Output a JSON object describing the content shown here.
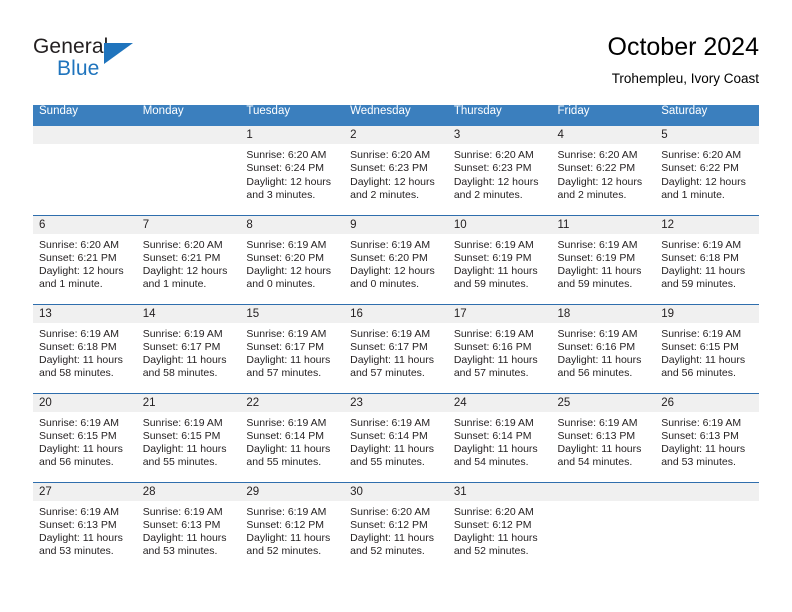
{
  "brand": {
    "name_part1": "General",
    "name_part2": "Blue",
    "triangle_icon": "triangle-icon",
    "accent_color": "#1f74bd"
  },
  "header": {
    "title": "October 2024",
    "subtitle": "Trohempleu, Ivory Coast"
  },
  "calendar": {
    "header_bg": "#3b7fbe",
    "row_divider": "#2f6ead",
    "daynum_bg": "#f0f0f0",
    "weekdays": [
      "Sunday",
      "Monday",
      "Tuesday",
      "Wednesday",
      "Thursday",
      "Friday",
      "Saturday"
    ],
    "weeks": [
      [
        {
          "day": "",
          "sunrise": "",
          "sunset": "",
          "daylight": "",
          "daylight2": "",
          "blank": true
        },
        {
          "day": "",
          "sunrise": "",
          "sunset": "",
          "daylight": "",
          "daylight2": "",
          "blank": true
        },
        {
          "day": "1",
          "sunrise": "Sunrise: 6:20 AM",
          "sunset": "Sunset: 6:24 PM",
          "daylight": "Daylight: 12 hours",
          "daylight2": "and 3 minutes."
        },
        {
          "day": "2",
          "sunrise": "Sunrise: 6:20 AM",
          "sunset": "Sunset: 6:23 PM",
          "daylight": "Daylight: 12 hours",
          "daylight2": "and 2 minutes."
        },
        {
          "day": "3",
          "sunrise": "Sunrise: 6:20 AM",
          "sunset": "Sunset: 6:23 PM",
          "daylight": "Daylight: 12 hours",
          "daylight2": "and 2 minutes."
        },
        {
          "day": "4",
          "sunrise": "Sunrise: 6:20 AM",
          "sunset": "Sunset: 6:22 PM",
          "daylight": "Daylight: 12 hours",
          "daylight2": "and 2 minutes."
        },
        {
          "day": "5",
          "sunrise": "Sunrise: 6:20 AM",
          "sunset": "Sunset: 6:22 PM",
          "daylight": "Daylight: 12 hours",
          "daylight2": "and 1 minute."
        }
      ],
      [
        {
          "day": "6",
          "sunrise": "Sunrise: 6:20 AM",
          "sunset": "Sunset: 6:21 PM",
          "daylight": "Daylight: 12 hours",
          "daylight2": "and 1 minute."
        },
        {
          "day": "7",
          "sunrise": "Sunrise: 6:20 AM",
          "sunset": "Sunset: 6:21 PM",
          "daylight": "Daylight: 12 hours",
          "daylight2": "and 1 minute."
        },
        {
          "day": "8",
          "sunrise": "Sunrise: 6:19 AM",
          "sunset": "Sunset: 6:20 PM",
          "daylight": "Daylight: 12 hours",
          "daylight2": "and 0 minutes."
        },
        {
          "day": "9",
          "sunrise": "Sunrise: 6:19 AM",
          "sunset": "Sunset: 6:20 PM",
          "daylight": "Daylight: 12 hours",
          "daylight2": "and 0 minutes."
        },
        {
          "day": "10",
          "sunrise": "Sunrise: 6:19 AM",
          "sunset": "Sunset: 6:19 PM",
          "daylight": "Daylight: 11 hours",
          "daylight2": "and 59 minutes."
        },
        {
          "day": "11",
          "sunrise": "Sunrise: 6:19 AM",
          "sunset": "Sunset: 6:19 PM",
          "daylight": "Daylight: 11 hours",
          "daylight2": "and 59 minutes."
        },
        {
          "day": "12",
          "sunrise": "Sunrise: 6:19 AM",
          "sunset": "Sunset: 6:18 PM",
          "daylight": "Daylight: 11 hours",
          "daylight2": "and 59 minutes."
        }
      ],
      [
        {
          "day": "13",
          "sunrise": "Sunrise: 6:19 AM",
          "sunset": "Sunset: 6:18 PM",
          "daylight": "Daylight: 11 hours",
          "daylight2": "and 58 minutes."
        },
        {
          "day": "14",
          "sunrise": "Sunrise: 6:19 AM",
          "sunset": "Sunset: 6:17 PM",
          "daylight": "Daylight: 11 hours",
          "daylight2": "and 58 minutes."
        },
        {
          "day": "15",
          "sunrise": "Sunrise: 6:19 AM",
          "sunset": "Sunset: 6:17 PM",
          "daylight": "Daylight: 11 hours",
          "daylight2": "and 57 minutes."
        },
        {
          "day": "16",
          "sunrise": "Sunrise: 6:19 AM",
          "sunset": "Sunset: 6:17 PM",
          "daylight": "Daylight: 11 hours",
          "daylight2": "and 57 minutes."
        },
        {
          "day": "17",
          "sunrise": "Sunrise: 6:19 AM",
          "sunset": "Sunset: 6:16 PM",
          "daylight": "Daylight: 11 hours",
          "daylight2": "and 57 minutes."
        },
        {
          "day": "18",
          "sunrise": "Sunrise: 6:19 AM",
          "sunset": "Sunset: 6:16 PM",
          "daylight": "Daylight: 11 hours",
          "daylight2": "and 56 minutes."
        },
        {
          "day": "19",
          "sunrise": "Sunrise: 6:19 AM",
          "sunset": "Sunset: 6:15 PM",
          "daylight": "Daylight: 11 hours",
          "daylight2": "and 56 minutes."
        }
      ],
      [
        {
          "day": "20",
          "sunrise": "Sunrise: 6:19 AM",
          "sunset": "Sunset: 6:15 PM",
          "daylight": "Daylight: 11 hours",
          "daylight2": "and 56 minutes."
        },
        {
          "day": "21",
          "sunrise": "Sunrise: 6:19 AM",
          "sunset": "Sunset: 6:15 PM",
          "daylight": "Daylight: 11 hours",
          "daylight2": "and 55 minutes."
        },
        {
          "day": "22",
          "sunrise": "Sunrise: 6:19 AM",
          "sunset": "Sunset: 6:14 PM",
          "daylight": "Daylight: 11 hours",
          "daylight2": "and 55 minutes."
        },
        {
          "day": "23",
          "sunrise": "Sunrise: 6:19 AM",
          "sunset": "Sunset: 6:14 PM",
          "daylight": "Daylight: 11 hours",
          "daylight2": "and 55 minutes."
        },
        {
          "day": "24",
          "sunrise": "Sunrise: 6:19 AM",
          "sunset": "Sunset: 6:14 PM",
          "daylight": "Daylight: 11 hours",
          "daylight2": "and 54 minutes."
        },
        {
          "day": "25",
          "sunrise": "Sunrise: 6:19 AM",
          "sunset": "Sunset: 6:13 PM",
          "daylight": "Daylight: 11 hours",
          "daylight2": "and 54 minutes."
        },
        {
          "day": "26",
          "sunrise": "Sunrise: 6:19 AM",
          "sunset": "Sunset: 6:13 PM",
          "daylight": "Daylight: 11 hours",
          "daylight2": "and 53 minutes."
        }
      ],
      [
        {
          "day": "27",
          "sunrise": "Sunrise: 6:19 AM",
          "sunset": "Sunset: 6:13 PM",
          "daylight": "Daylight: 11 hours",
          "daylight2": "and 53 minutes."
        },
        {
          "day": "28",
          "sunrise": "Sunrise: 6:19 AM",
          "sunset": "Sunset: 6:13 PM",
          "daylight": "Daylight: 11 hours",
          "daylight2": "and 53 minutes."
        },
        {
          "day": "29",
          "sunrise": "Sunrise: 6:19 AM",
          "sunset": "Sunset: 6:12 PM",
          "daylight": "Daylight: 11 hours",
          "daylight2": "and 52 minutes."
        },
        {
          "day": "30",
          "sunrise": "Sunrise: 6:20 AM",
          "sunset": "Sunset: 6:12 PM",
          "daylight": "Daylight: 11 hours",
          "daylight2": "and 52 minutes."
        },
        {
          "day": "31",
          "sunrise": "Sunrise: 6:20 AM",
          "sunset": "Sunset: 6:12 PM",
          "daylight": "Daylight: 11 hours",
          "daylight2": "and 52 minutes."
        },
        {
          "day": "",
          "sunrise": "",
          "sunset": "",
          "daylight": "",
          "daylight2": "",
          "blank": true
        },
        {
          "day": "",
          "sunrise": "",
          "sunset": "",
          "daylight": "",
          "daylight2": "",
          "blank": true
        }
      ]
    ]
  }
}
